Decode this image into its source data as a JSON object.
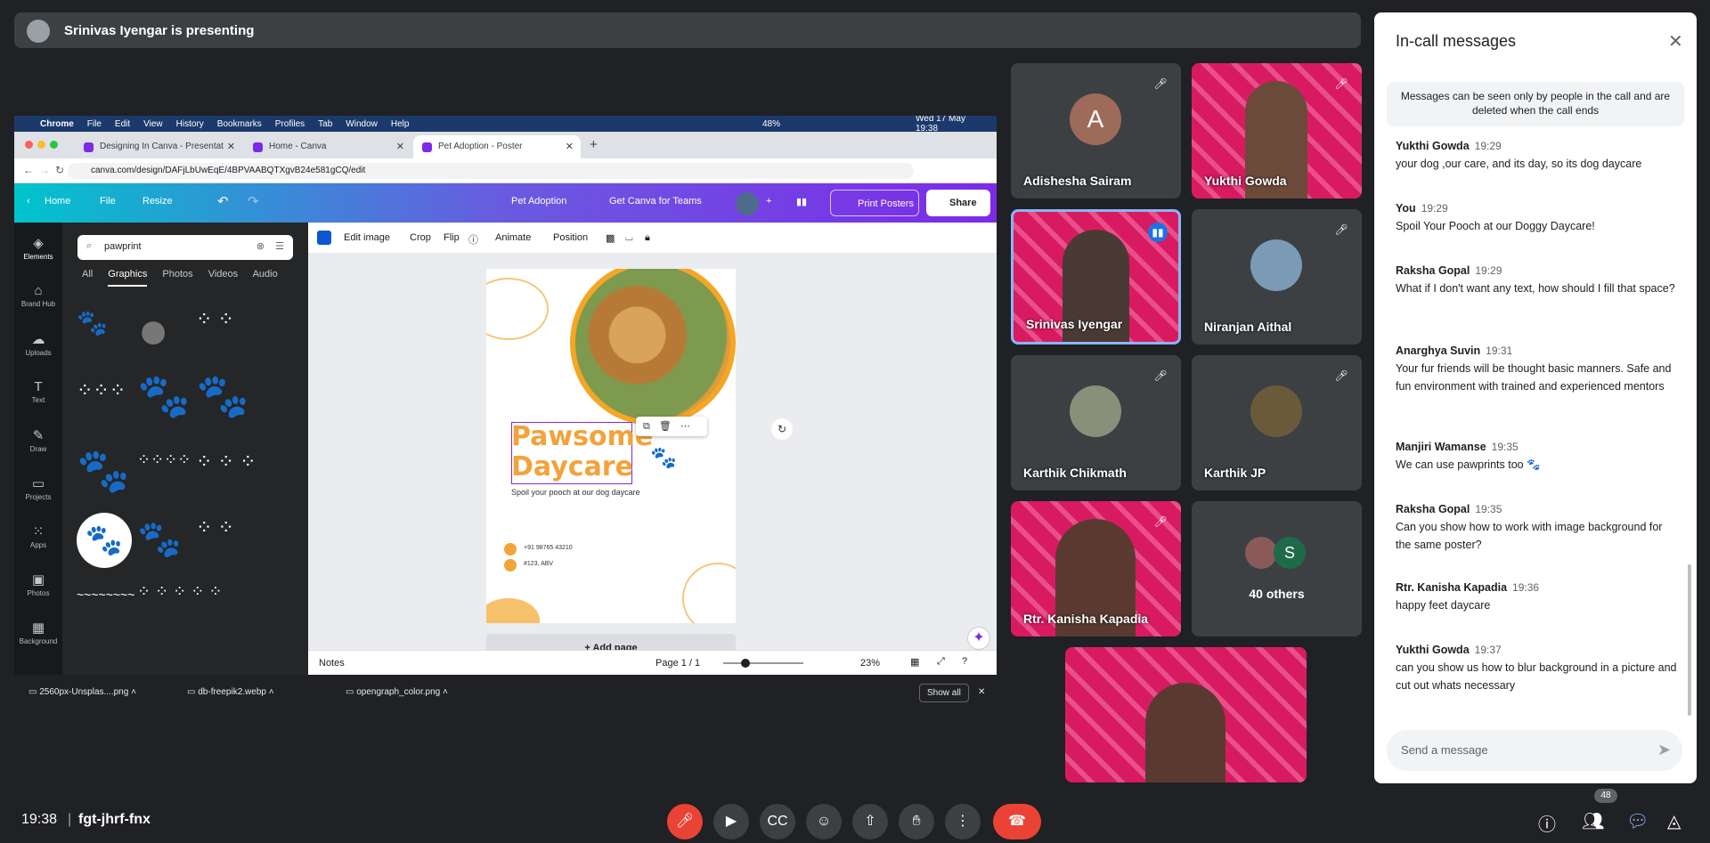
{
  "presenting_banner": "Srinivas Iyengar is presenting",
  "mac_menu": {
    "items": [
      "Chrome",
      "File",
      "Edit",
      "View",
      "History",
      "Bookmarks",
      "Profiles",
      "Tab",
      "Window",
      "Help"
    ],
    "battery": "48%",
    "datetime": "Wed 17 May 19:38"
  },
  "browser": {
    "tabs": [
      "Designing In Canva - Presentat",
      "Home - Canva",
      "Pet Adoption - Poster"
    ],
    "url": "canva.com/design/DAFjLbUwEqE/4BPVAABQTXgvB24e581gCQ/edit"
  },
  "canva_top": {
    "home": "Home",
    "file": "File",
    "resize": "Resize",
    "doc_title": "Pet Adoption",
    "teams": "Get Canva for Teams",
    "print": "Print Posters",
    "share": "Share"
  },
  "rail": [
    "Elements",
    "Brand Hub",
    "Uploads",
    "Text",
    "Draw",
    "Projects",
    "Apps",
    "Photos",
    "Background"
  ],
  "panel": {
    "search_value": "pawprint",
    "tabs": [
      "All",
      "Graphics",
      "Photos",
      "Videos",
      "Audio"
    ]
  },
  "editor_toolbar": [
    "Edit image",
    "Crop",
    "Flip",
    "Animate",
    "Position"
  ],
  "poster": {
    "headline1": "Pawsome",
    "headline2": "Daycare",
    "tagline": "Spoil your pooch at our dog daycare",
    "phone": "+91 98765 43210",
    "address": "#123, ABV"
  },
  "add_page": "+ Add page",
  "editor_footer": {
    "notes": "Notes",
    "page": "Page 1 / 1",
    "zoom": "23%"
  },
  "downloads": {
    "files": [
      "2560px-Unsplas....png",
      "db-freepik2.webp",
      "opengraph_color.png"
    ],
    "show_all": "Show all"
  },
  "participants": [
    {
      "name": "Adishesha Sairam",
      "initial": "A"
    },
    {
      "name": "Yukthi Gowda"
    },
    {
      "name": "Srinivas Iyengar"
    },
    {
      "name": "Niranjan Aithal"
    },
    {
      "name": "Karthik Chikmath"
    },
    {
      "name": "Karthik JP"
    },
    {
      "name": "Rtr. Kanisha Kapadia"
    },
    {
      "name": "40 others",
      "initial": "S"
    }
  ],
  "chat": {
    "title": "In-call messages",
    "notice": "Messages can be seen only by people in the call and are deleted when the call ends",
    "messages": [
      {
        "who": "Yukthi Gowda",
        "time": "19:29",
        "text": "your dog ,our care, and its day, so its dog daycare"
      },
      {
        "who": "You",
        "time": "19:29",
        "text": "Spoil Your Pooch at our Doggy Daycare!"
      },
      {
        "who": "Raksha Gopal",
        "time": "19:29",
        "text": "What if I don't want any text,  how should I fill that space?"
      },
      {
        "who": "Anarghya Suvin",
        "time": "19:31",
        "text": "Your fur friends will be thought basic manners. Safe and fun environment with trained and experienced mentors"
      },
      {
        "who": "Manjiri Wamanse",
        "time": "19:35",
        "text": "We can use pawprints too 🐾"
      },
      {
        "who": "Raksha Gopal",
        "time": "19:35",
        "text": "Can you show how to work with image background for the same poster?"
      },
      {
        "who": "Rtr. Kanisha Kapadia",
        "time": "19:36",
        "text": "happy feet daycare"
      },
      {
        "who": "Yukthi Gowda",
        "time": "19:37",
        "text": "can you show us how to blur background in a picture and cut out whats necessary"
      }
    ],
    "input_placeholder": "Send a message"
  },
  "meeting": {
    "time": "19:38",
    "code": "fgt-jhrf-fnx",
    "participant_count": "48"
  }
}
